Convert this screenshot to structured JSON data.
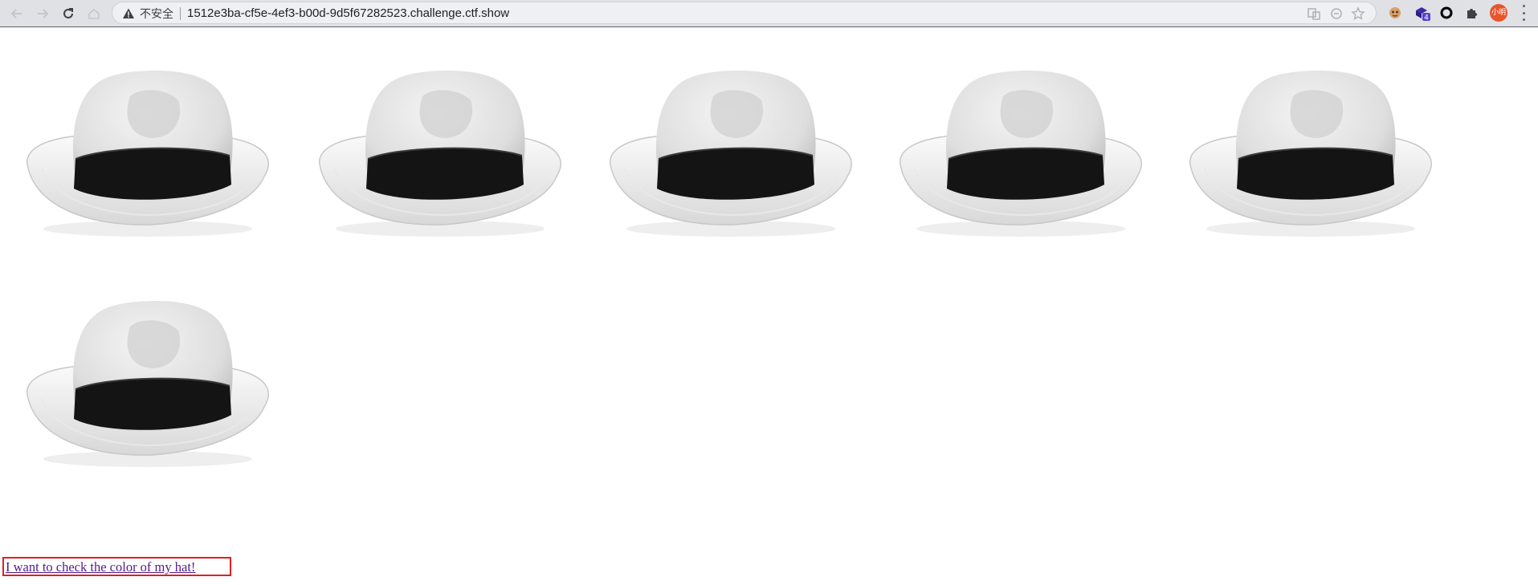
{
  "browser": {
    "security_label": "不安全",
    "url": "1512e3ba-cf5e-4ef3-b00d-9d5f67282523.challenge.ctf.show",
    "extension_badge": "4",
    "profile_label": "小明"
  },
  "page": {
    "hat_count": 6,
    "link_text": "I want to check the color of my hat!"
  },
  "colors": {
    "link": "#551a8b",
    "highlight_box": "#e02020",
    "profile": "#e8552d"
  }
}
